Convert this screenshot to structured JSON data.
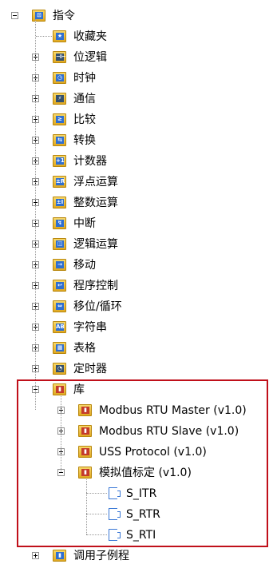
{
  "tree": {
    "root": {
      "label": "指令",
      "icon": "instructions-folder-icon"
    },
    "items": [
      {
        "label": "收藏夹",
        "icon": "favorites-icon"
      },
      {
        "label": "位逻辑",
        "icon": "bit-logic-icon"
      },
      {
        "label": "时钟",
        "icon": "clock-icon"
      },
      {
        "label": "通信",
        "icon": "communication-icon"
      },
      {
        "label": "比较",
        "icon": "compare-icon"
      },
      {
        "label": "转换",
        "icon": "convert-icon"
      },
      {
        "label": "计数器",
        "icon": "counter-icon"
      },
      {
        "label": "浮点运算",
        "icon": "float-math-icon"
      },
      {
        "label": "整数运算",
        "icon": "integer-math-icon"
      },
      {
        "label": "中断",
        "icon": "interrupt-icon"
      },
      {
        "label": "逻辑运算",
        "icon": "logic-ops-icon"
      },
      {
        "label": "移动",
        "icon": "move-icon"
      },
      {
        "label": "程序控制",
        "icon": "program-control-icon"
      },
      {
        "label": "移位/循环",
        "icon": "shift-rotate-icon"
      },
      {
        "label": "字符串",
        "icon": "string-icon"
      },
      {
        "label": "表格",
        "icon": "table-icon"
      },
      {
        "label": "定时器",
        "icon": "timer-icon"
      },
      {
        "label": "库",
        "icon": "library-folder-icon"
      }
    ],
    "library_children": [
      {
        "label": "Modbus RTU Master (v1.0)"
      },
      {
        "label": "Modbus RTU Slave (v1.0)"
      },
      {
        "label": "USS Protocol (v1.0)"
      },
      {
        "label": "模拟值标定 (v1.0)"
      }
    ],
    "scaling_children": [
      {
        "label": "S_ITR"
      },
      {
        "label": "S_RTR"
      },
      {
        "label": "S_RTI"
      }
    ],
    "last_item": {
      "label": "调用子例程"
    }
  },
  "icon_glyphs": [
    "★",
    "⊣⊢",
    "◷",
    "⚡",
    "≥",
    "⇆",
    "+1",
    "±R",
    "±I",
    "↯",
    "◫",
    "→",
    "↩",
    "⇔",
    "AB",
    "▦",
    "◔",
    "▮"
  ],
  "colors": {
    "highlight_border": "#c0101a",
    "folder": "#e0a822"
  }
}
